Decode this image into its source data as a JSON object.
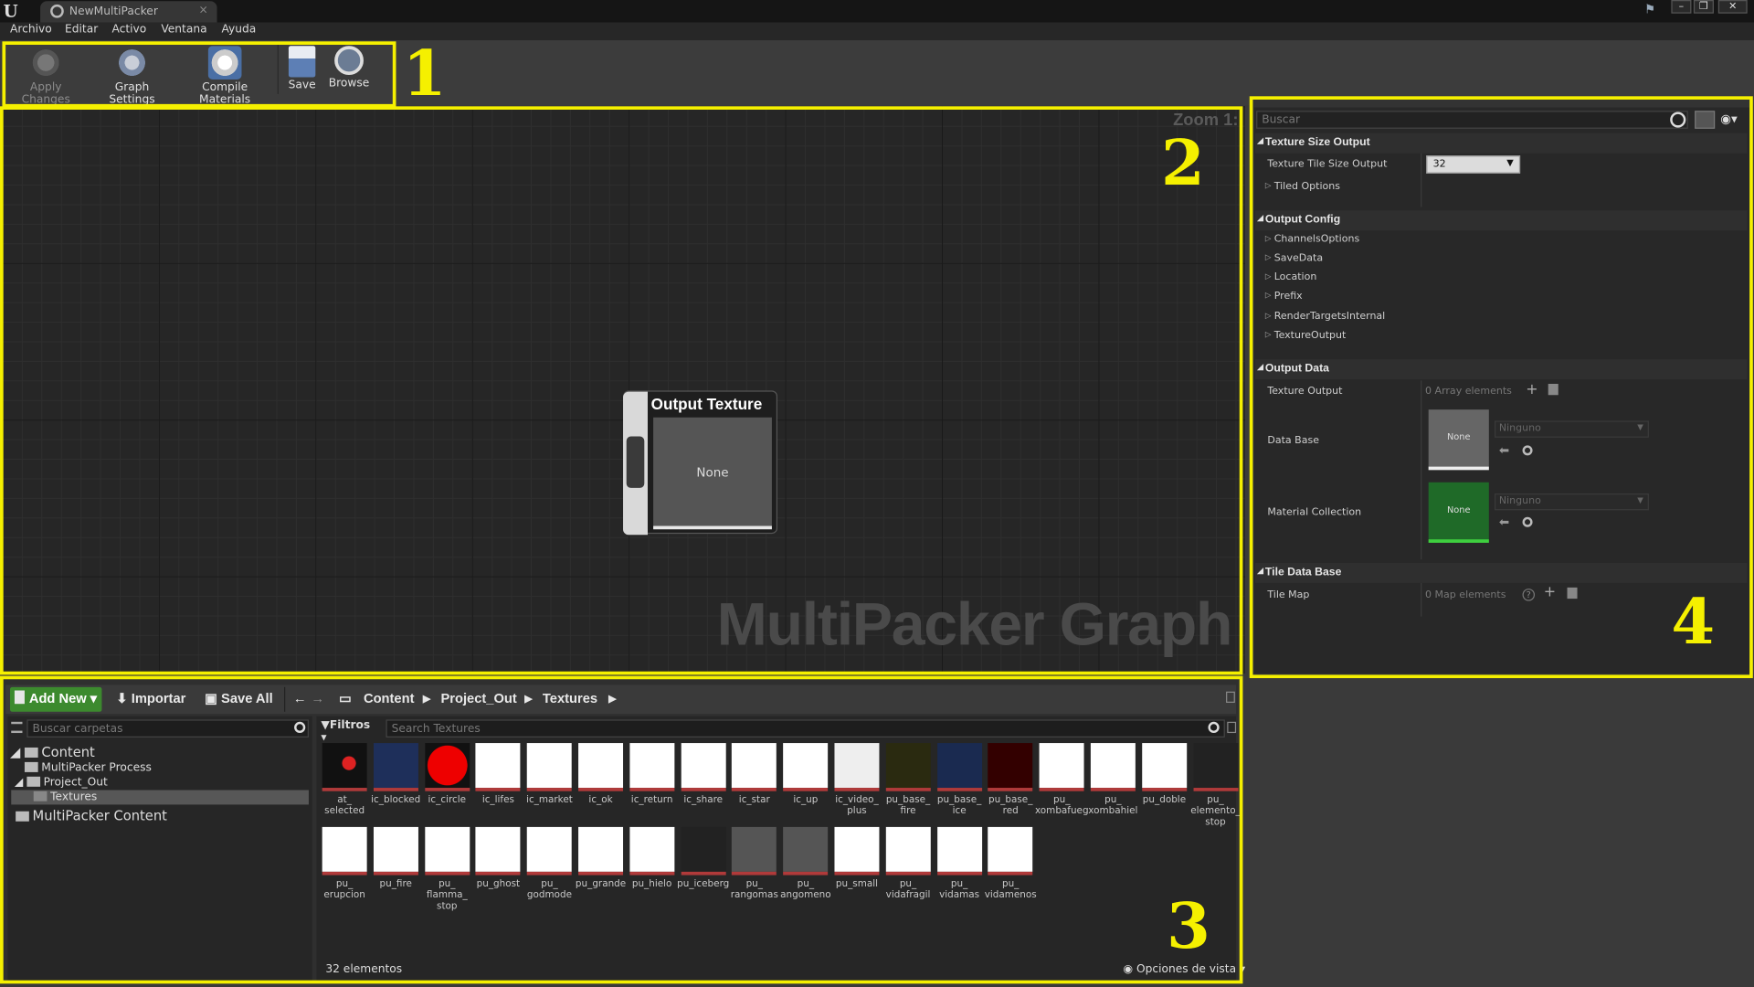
{
  "window": {
    "tab_title": "NewMultiPacker",
    "logo": "U"
  },
  "menu": [
    "Archivo",
    "Editar",
    "Activo",
    "Ventana",
    "Ayuda"
  ],
  "toolbar": {
    "apply": "Apply Changes",
    "graph_settings": "Graph Settings",
    "compile": "Compile Materials",
    "save": "Save",
    "browse": "Browse"
  },
  "annotations": [
    "1",
    "2",
    "3",
    "4"
  ],
  "graph": {
    "zoom": "Zoom 1:",
    "watermark": "MultiPacker Graph",
    "node_title": "Output Texture",
    "node_preview": "None"
  },
  "details": {
    "search_placeholder": "Buscar",
    "cat1": "Texture Size Output",
    "tile_size_label": "Texture Tile Size Output",
    "tile_size_value": "32",
    "tiled_options": "Tiled Options",
    "cat2": "Output Config",
    "config_items": [
      "ChannelsOptions",
      "SaveData",
      "Location",
      "Prefix",
      "RenderTargetsInternal",
      "TextureOutput"
    ],
    "cat3": "Output Data",
    "texture_output": "Texture Output",
    "array_elements": "0 Array elements",
    "data_base": "Data Base",
    "material_collection": "Material Collection",
    "none": "None",
    "ninguno": "Ninguno",
    "cat4": "Tile Data Base",
    "tile_map": "Tile Map",
    "map_elements": "0 Map elements"
  },
  "content_browser": {
    "add_new": "Add New",
    "import": "Importar",
    "save_all": "Save All",
    "breadcrumb": [
      "Content",
      "Project_Out",
      "Textures"
    ],
    "folder_search": "Buscar carpetas",
    "folders": {
      "content": "Content",
      "process": "MultiPacker Process",
      "project_out": "Project_Out",
      "textures": "Textures",
      "mp_content": "MultiPacker Content"
    },
    "filters": "Filtros",
    "asset_search": "Search Textures",
    "count": "32 elementos",
    "view_options": "Opciones de vista",
    "assets_row1": [
      "at_\nselected",
      "ic_blocked",
      "ic_circle",
      "ic_lifes",
      "ic_market",
      "ic_ok",
      "ic_return",
      "ic_share",
      "ic_star",
      "ic_up",
      "ic_video_\nplus",
      "pu_base_\nfire",
      "pu_base_\nice",
      "pu_base_\nred",
      "pu_\nxombafueg",
      "pu_\nxombahiel",
      "pu_doble",
      "pu_\nelemento_\nstop"
    ],
    "assets_row2": [
      "pu_\nerupcion",
      "pu_fire",
      "pu_\nflamma_\nstop",
      "pu_ghost",
      "pu_\ngodmode",
      "pu_grande",
      "pu_hielo",
      "pu_iceberg",
      "pu_\nrangomas",
      "pu_\nangomeno",
      "pu_small",
      "pu_\nvidafragil",
      "pu_\nvidamas",
      "pu_\nvidamenos"
    ]
  }
}
